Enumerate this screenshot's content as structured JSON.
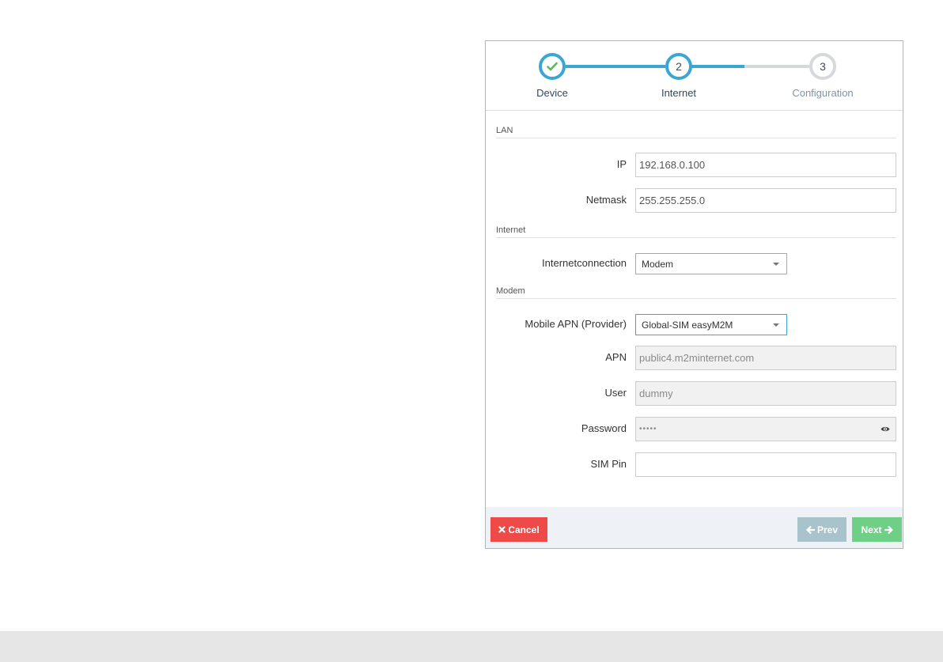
{
  "stepper": {
    "steps": [
      {
        "number": "",
        "label": "Device",
        "state": "done",
        "icon": "check-icon"
      },
      {
        "number": "2",
        "label": "Internet",
        "state": "active"
      },
      {
        "number": "3",
        "label": "Configuration",
        "state": "todo"
      }
    ]
  },
  "lan": {
    "title": "LAN",
    "ip_label": "IP",
    "ip_value": "192.168.0.100",
    "netmask_label": "Netmask",
    "netmask_value": "255.255.255.0"
  },
  "internet": {
    "title": "Internet",
    "connection_label": "Internetconnection",
    "connection_value": "Modem"
  },
  "modem": {
    "title": "Modem",
    "apn_provider_label": "Mobile APN (Provider)",
    "apn_provider_value": "Global-SIM easyM2M",
    "apn_label": "APN",
    "apn_value": "public4.m2minternet.com",
    "user_label": "User",
    "user_value": "dummy",
    "password_label": "Password",
    "password_value": "•••••",
    "sim_pin_label": "SIM Pin",
    "sim_pin_value": ""
  },
  "buttons": {
    "cancel_label": "Cancel",
    "prev_label": "Prev",
    "next_label": "Next"
  },
  "colors": {
    "accent": "#3ca6d3",
    "check": "#5cb85c",
    "cancel": "#ee4a48",
    "prev": "#a9c3cc",
    "next": "#6fcf86"
  }
}
